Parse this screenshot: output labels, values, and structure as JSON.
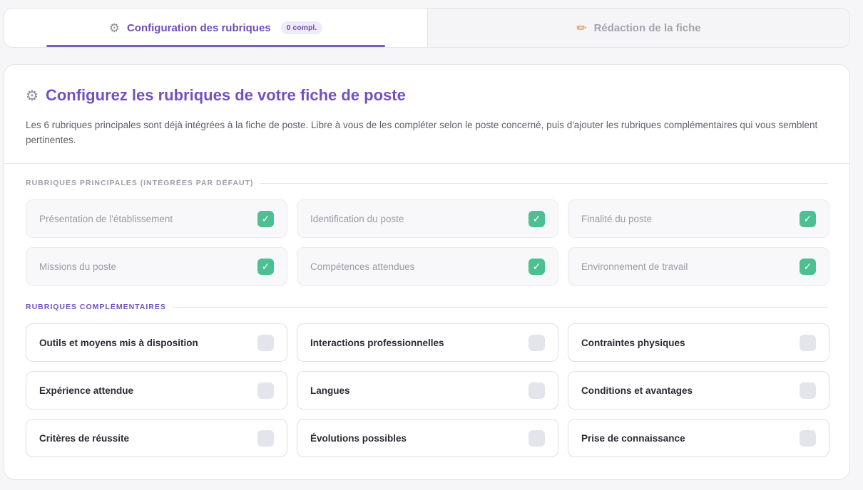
{
  "tabs": [
    {
      "label": "Configuration des rubriques",
      "badge": "0 compl.",
      "icon": "gear-icon",
      "active": true
    },
    {
      "label": "Rédaction de la fiche",
      "icon": "pencil-icon",
      "active": false
    }
  ],
  "header": {
    "title": "Configurez les rubriques de votre fiche de poste",
    "description": "Les 6 rubriques principales sont déjà intégrées à la fiche de poste. Libre à vous de les compléter selon le poste concerné, puis d'ajouter les rubriques complémentaires qui vous semblent pertinentes."
  },
  "sections": {
    "main_label": "RUBRIQUES PRINCIPALES (INTÉGRÉES PAR DÉFAUT)",
    "extra_label": "RUBRIQUES COMPLÉMENTAIRES"
  },
  "main_items": [
    {
      "label": "Présentation de l'établissement",
      "checked": true
    },
    {
      "label": "Identification du poste",
      "checked": true
    },
    {
      "label": "Finalité du poste",
      "checked": true
    },
    {
      "label": "Missions du poste",
      "checked": true
    },
    {
      "label": "Compétences attendues",
      "checked": true
    },
    {
      "label": "Environnement de travail",
      "checked": true
    }
  ],
  "extra_items": [
    {
      "label": "Outils et moyens mis à disposition",
      "checked": false
    },
    {
      "label": "Interactions professionnelles",
      "checked": false
    },
    {
      "label": "Contraintes physiques",
      "checked": false
    },
    {
      "label": "Expérience attendue",
      "checked": false
    },
    {
      "label": "Langues",
      "checked": false
    },
    {
      "label": "Conditions et avantages",
      "checked": false
    },
    {
      "label": "Critères de réussite",
      "checked": false
    },
    {
      "label": "Évolutions possibles",
      "checked": false
    },
    {
      "label": "Prise de connaissance",
      "checked": false
    }
  ],
  "check_glyph": "✓",
  "colors": {
    "accent": "#7351c2",
    "check": "#4cbf93"
  }
}
